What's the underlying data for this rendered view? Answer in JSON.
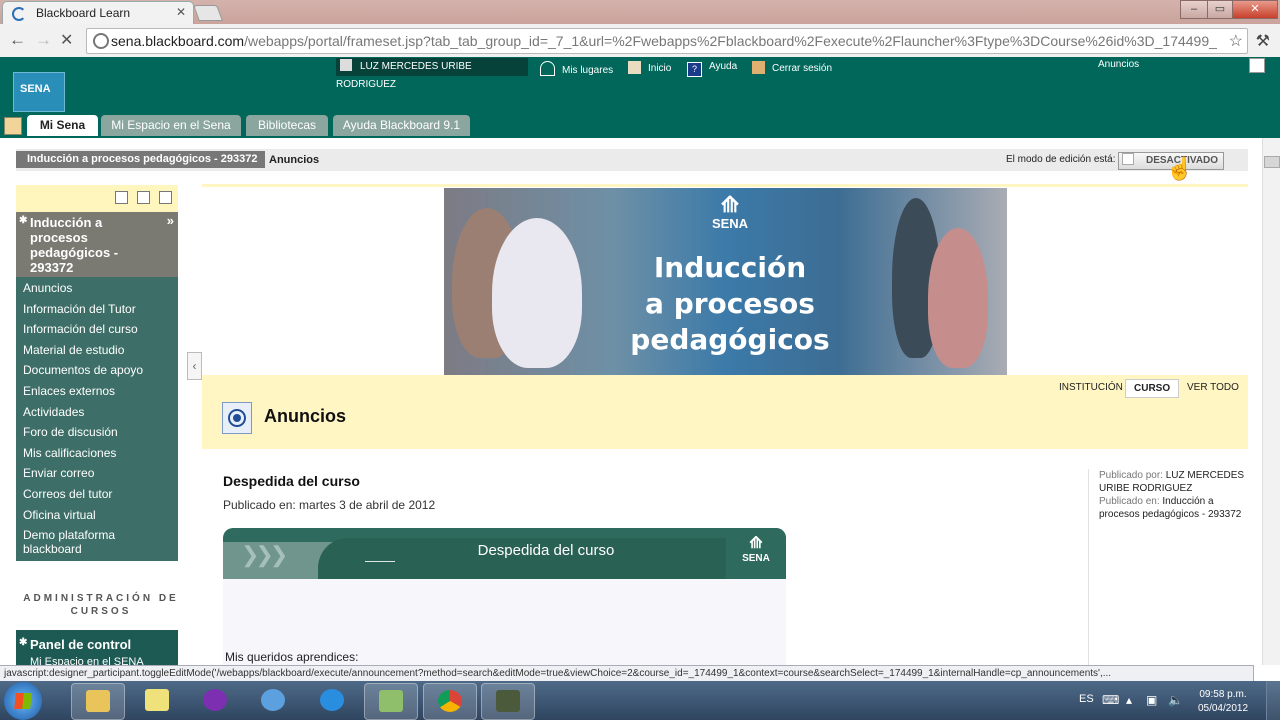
{
  "browser": {
    "tab_title": "Blackboard Learn",
    "tab_close": "✕",
    "url_host": "sena.blackboard.com",
    "url_path": "/webapps/portal/frameset.jsp?tab_tab_group_id=_7_1&url=%2Fwebapps%2Fblackboard%2Fexecute%2Flauncher%3Ftype%3DCourse%26id%3D_174499_1%26",
    "window_buttons": [
      "–",
      "▭",
      "✕"
    ]
  },
  "header": {
    "logo_text": "SENA",
    "user_name": "LUZ MERCEDES URIBE RODRIGUEZ",
    "links": [
      "Mis lugares",
      "Inicio",
      "Ayuda",
      "Cerrar sesión"
    ],
    "top_right": "Anuncios",
    "tabs": [
      "Mi Sena",
      "Mi Espacio en el Sena",
      "Bibliotecas",
      "Ayuda Blackboard 9.1"
    ],
    "active_tab": "Mi Sena"
  },
  "breadcrumb": {
    "course": "Inducción a procesos pedagógicos - 293372",
    "page": "Anuncios",
    "edit_mode_label": "El modo de edición está:",
    "edit_mode_value": "DESACTIVADO"
  },
  "course_menu": {
    "title": "Inducción a procesos pedagógicos - 293372",
    "items": [
      "Anuncios",
      "Información del Tutor",
      "Información del curso",
      "Material de estudio",
      "Documentos de apoyo",
      "Enlaces externos",
      "Actividades",
      "Foro de discusión",
      "Mis calificaciones",
      "Enviar correo",
      "Correos del tutor",
      "Oficina virtual",
      "Demo plataforma blackboard"
    ],
    "admin_title": "ADMINISTRACIÓN DE CURSOS",
    "panel_title": "Panel de control",
    "panel_sub": "Mi Espacio en el SENA"
  },
  "banner": {
    "logo_text": "SENA",
    "title_lines": [
      "Inducción",
      "a procesos",
      "pedagógicos"
    ]
  },
  "announcements": {
    "filters": [
      "INSTITUCIÓN",
      "CURSO",
      "VER TODO"
    ],
    "active_filter": "CURSO",
    "heading": "Anuncios",
    "post": {
      "title": "Despedida del curso",
      "date": "Publicado en: martes 3 de abril de 2012",
      "banner_text": "Despedida del curso",
      "banner_logo": "SENA",
      "greeting": "Mis queridos aprendices:"
    },
    "meta": {
      "by_label": "Publicado por:",
      "by_value": "LUZ MERCEDES URIBE RODRIGUEZ",
      "in_label": "Publicado en:",
      "in_value": "Inducción a procesos pedagógicos - 293372"
    }
  },
  "statusbar": "javascript:designer_participant.toggleEditMode('/webapps/blackboard/execute/announcement?method=search&editMode=true&viewChoice=2&course_id=_174499_1&context=course&searchSelect=_174499_1&internalHandle=cp_announcements',...",
  "taskbar": {
    "language": "ES",
    "time": "09:58 p.m.",
    "date": "05/04/2012"
  }
}
